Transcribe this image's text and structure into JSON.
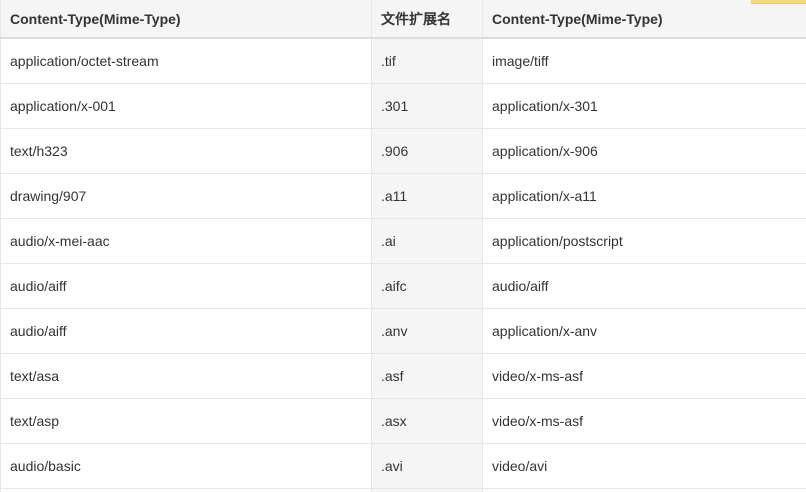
{
  "table": {
    "headers": [
      "Content-Type(Mime-Type)",
      "文件扩展名",
      "Content-Type(Mime-Type)"
    ],
    "rows": [
      [
        "application/octet-stream",
        ".tif",
        "image/tiff"
      ],
      [
        "application/x-001",
        ".301",
        "application/x-301"
      ],
      [
        "text/h323",
        ".906",
        "application/x-906"
      ],
      [
        "drawing/907",
        ".a11",
        "application/x-a11"
      ],
      [
        "audio/x-mei-aac",
        ".ai",
        "application/postscript"
      ],
      [
        "audio/aiff",
        ".aifc",
        "audio/aiff"
      ],
      [
        "audio/aiff",
        ".anv",
        "application/x-anv"
      ],
      [
        "text/asa",
        ".asf",
        "video/x-ms-asf"
      ],
      [
        "text/asp",
        ".asx",
        "video/x-ms-asf"
      ],
      [
        "audio/basic",
        ".avi",
        "video/avi"
      ]
    ]
  },
  "colors": {
    "header_bg": "#f5f5f5",
    "ext_column_bg": "#f5f5f5",
    "border": "#e6e6e6",
    "text": "#333333",
    "corner_tab": "#f5d78a"
  }
}
